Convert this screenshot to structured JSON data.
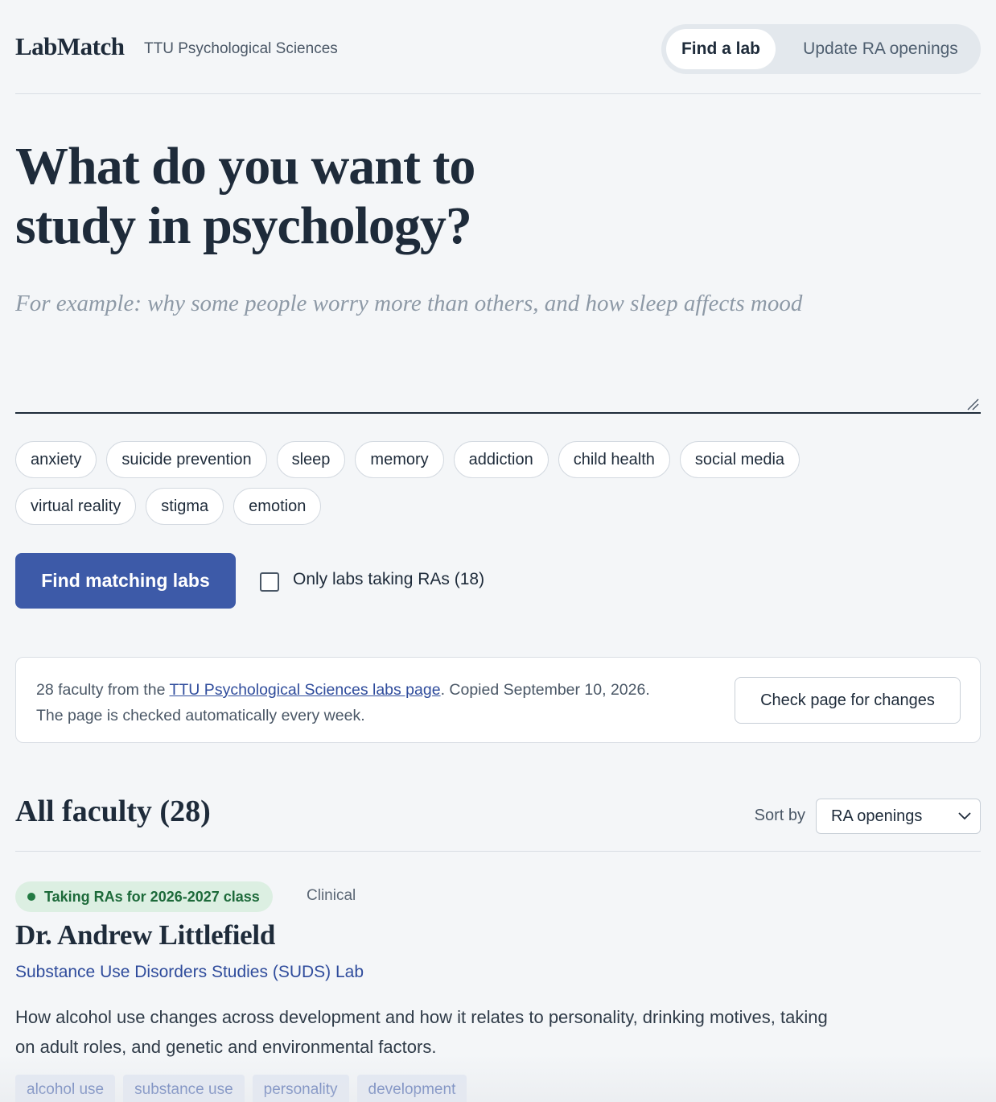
{
  "header": {
    "logo": "LabMatch",
    "dept": "TTU Psychological Sciences",
    "nav": {
      "find": "Find a lab",
      "update": "Update RA openings"
    }
  },
  "hero": {
    "title_line1": "What do you want to",
    "title_line2": "study in psychology?",
    "query_placeholder": "For example: why some people worry more than others, and how sleep affects mood",
    "query_value": ""
  },
  "chips": {
    "row1": [
      "anxiety",
      "suicide prevention",
      "sleep",
      "memory",
      "addiction",
      "child health",
      "social media"
    ],
    "row2": [
      "virtual reality",
      "stigma",
      "emotion"
    ]
  },
  "actions": {
    "find_label": "Find matching labs",
    "ra_filter_label": "Only labs taking RAs (18)",
    "ra_filter_checked": false
  },
  "info": {
    "pre": "28 faculty from the ",
    "link": "TTU Psychological Sciences labs page",
    "post": ". Copied September 10, 2026.",
    "line2": "The page is checked automatically every week.",
    "check_label": "Check page for changes"
  },
  "results": {
    "title": "All faculty (28)",
    "sort_label": "Sort by",
    "sort_value": "RA openings"
  },
  "faculty": [
    {
      "badge": "Taking RAs for 2026-2027 class",
      "area": "Clinical",
      "name": "Dr. Andrew Littlefield",
      "lab": "Substance Use Disorders Studies (SUDS) Lab",
      "description": "How alcohol use changes across development and how it relates to personality, drinking motives, taking on adult roles, and genetic and environmental factors.",
      "tags": [
        "alcohol use",
        "substance use",
        "personality",
        "development"
      ]
    }
  ],
  "colors": {
    "background": "#f4f6f8",
    "primary": "#3d5aa8",
    "text": "#1e2b3a",
    "badge_bg": "#dcefe2",
    "badge_text": "#1d6a3a"
  }
}
